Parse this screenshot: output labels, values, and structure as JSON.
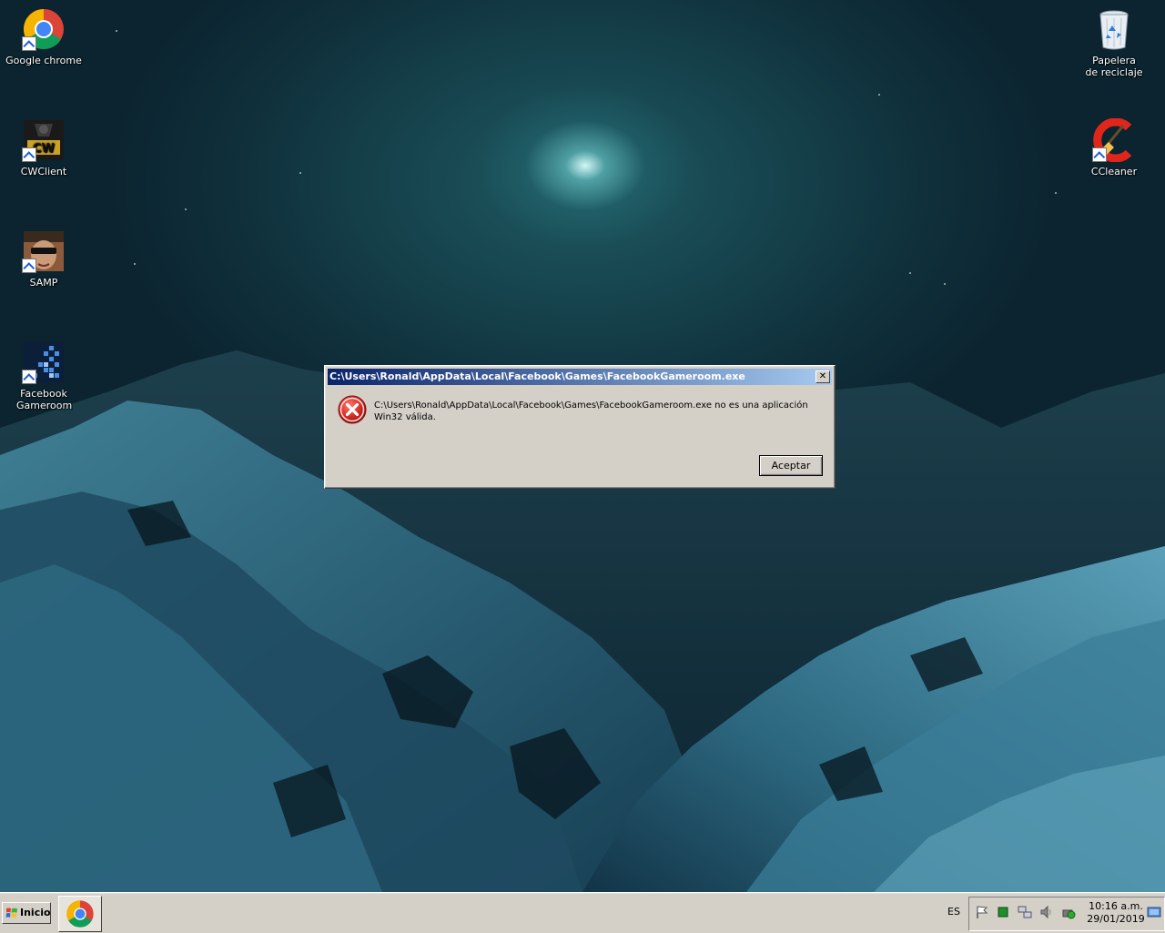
{
  "desktop": {
    "icons_left": [
      {
        "label": "Google chrome",
        "icon": "chrome-icon"
      },
      {
        "label": "CWClient",
        "icon": "cwclient-icon"
      },
      {
        "label": "SAMP",
        "icon": "samp-icon"
      },
      {
        "label": "Facebook Gameroom",
        "icon": "facebook-gameroom-icon"
      }
    ],
    "icons_right": [
      {
        "label": "Papelera de reciclaje",
        "icon": "recycle-bin-icon"
      },
      {
        "label": "CCleaner",
        "icon": "ccleaner-icon"
      }
    ]
  },
  "dialog": {
    "title": "C:\\Users\\Ronald\\AppData\\Local\\Facebook\\Games\\FacebookGameroom.exe",
    "message": "C:\\Users\\Ronald\\AppData\\Local\\Facebook\\Games\\FacebookGameroom.exe no es una aplicación Win32 válida.",
    "ok_label": "Aceptar",
    "close_glyph": "✕",
    "icon": "error-icon"
  },
  "taskbar": {
    "start_label": "Inicio",
    "pinned": [
      "chrome-icon"
    ],
    "language": "ES",
    "time": "10:16 a.m.",
    "date": "29/01/2019",
    "tray_icons": [
      "flag-icon",
      "green-square-icon",
      "network-icon",
      "volume-icon",
      "power-icon",
      "show-desktop-icon"
    ]
  },
  "colors": {
    "titlebar_start": "#0a246a",
    "titlebar_end": "#a6caf0",
    "dialog_bg": "#d4d0c8",
    "error_red": "#c8201c"
  }
}
